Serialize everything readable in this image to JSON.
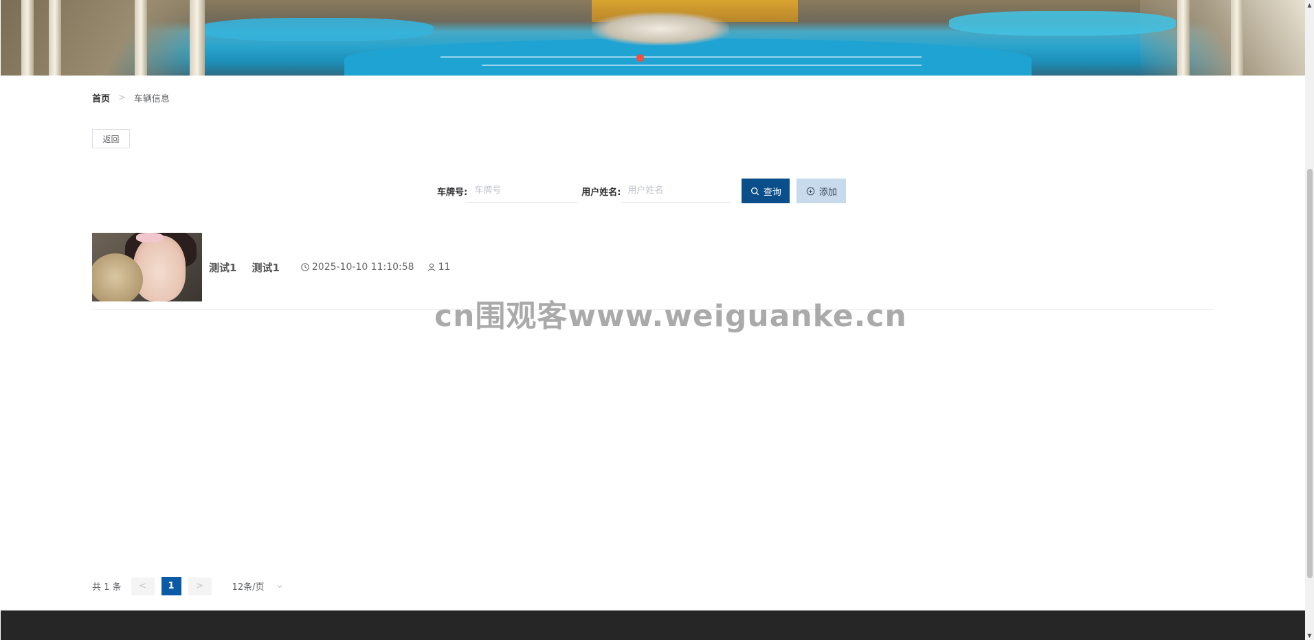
{
  "banner": {
    "alt_subject": "outdoor-thermal-pool-photo",
    "active_dot_color": "#f0503c"
  },
  "breadcrumb": {
    "home": "首页",
    "separator": ">",
    "current": "车辆信息"
  },
  "toolbar": {
    "back_label": "返回"
  },
  "search": {
    "plate_label": "车牌号:",
    "plate_placeholder": "车牌号",
    "username_label": "用户姓名:",
    "username_placeholder": "用户姓名",
    "search_label": "查询",
    "add_label": "添加",
    "search_icon": "search-icon",
    "add_icon": "plus-circle-icon",
    "search_button_color": "#0b4f8a",
    "add_button_color": "#c8dbec"
  },
  "list": {
    "items": [
      {
        "title_1": "测试1",
        "title_2": "测试1",
        "time": "2025-10-10 11:10:58",
        "count": "11",
        "time_icon": "clock-icon",
        "count_icon": "user-icon"
      }
    ]
  },
  "watermark": "cn围观客www.weiguanke.cn",
  "pagination": {
    "total": "共 1 条",
    "prev": "<",
    "page": "1",
    "next": ">",
    "page_size": "12条/页",
    "active_color": "#0b5aa6"
  },
  "footer": {
    "color": "#262626"
  }
}
